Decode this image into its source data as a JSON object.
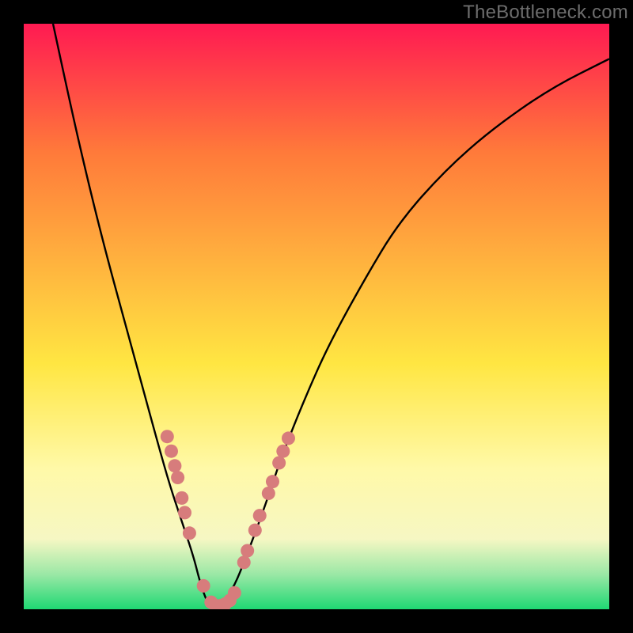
{
  "watermark": "TheBottleneck.com",
  "colors": {
    "black": "#000000",
    "curve": "#000000",
    "marker_fill": "#d77c7c",
    "marker_stroke": "#b85e5e",
    "gradient_top": "#ff1a52",
    "gradient_mid_orange": "#ff7a3a",
    "gradient_yellow": "#ffe642",
    "gradient_pale_yellow": "#fff9a8",
    "gradient_cream": "#f6f7c3",
    "gradient_mint": "#9be8a6",
    "gradient_green": "#1fd873"
  },
  "chart_data": {
    "type": "line",
    "title": "",
    "xlabel": "",
    "ylabel": "",
    "xlim": [
      0,
      100
    ],
    "ylim": [
      0,
      100
    ],
    "series": [
      {
        "name": "bottleneck-curve",
        "x": [
          5,
          8,
          11,
          14,
          17,
          20,
          23,
          25,
          27,
          29,
          30,
          31,
          32,
          33,
          34,
          36,
          38,
          41,
          44,
          48,
          52,
          58,
          64,
          72,
          80,
          90,
          100
        ],
        "y": [
          100,
          86,
          73,
          61,
          50,
          39,
          28,
          21,
          15,
          9,
          5,
          2,
          0,
          0,
          1,
          4,
          9,
          17,
          26,
          36,
          45,
          56,
          66,
          75,
          82,
          89,
          94
        ]
      }
    ],
    "markers": [
      {
        "x": 24.5,
        "y": 29.5
      },
      {
        "x": 25.2,
        "y": 27.0
      },
      {
        "x": 25.8,
        "y": 24.5
      },
      {
        "x": 26.3,
        "y": 22.5
      },
      {
        "x": 27.0,
        "y": 19.0
      },
      {
        "x": 27.5,
        "y": 16.5
      },
      {
        "x": 28.3,
        "y": 13.0
      },
      {
        "x": 30.7,
        "y": 4.0
      },
      {
        "x": 32.0,
        "y": 1.2
      },
      {
        "x": 32.8,
        "y": 0.6
      },
      {
        "x": 33.6,
        "y": 0.6
      },
      {
        "x": 34.4,
        "y": 0.9
      },
      {
        "x": 35.2,
        "y": 1.5
      },
      {
        "x": 36.0,
        "y": 2.8
      },
      {
        "x": 37.6,
        "y": 8.0
      },
      {
        "x": 38.2,
        "y": 10.0
      },
      {
        "x": 39.5,
        "y": 13.5
      },
      {
        "x": 40.3,
        "y": 16.0
      },
      {
        "x": 41.8,
        "y": 19.8
      },
      {
        "x": 42.5,
        "y": 21.8
      },
      {
        "x": 43.6,
        "y": 25.0
      },
      {
        "x": 44.3,
        "y": 27.0
      },
      {
        "x": 45.2,
        "y": 29.2
      }
    ],
    "gradient_stops": [
      {
        "offset": 0.0,
        "color_key": "gradient_top"
      },
      {
        "offset": 0.22,
        "color_key": "gradient_mid_orange"
      },
      {
        "offset": 0.58,
        "color_key": "gradient_yellow"
      },
      {
        "offset": 0.76,
        "color_key": "gradient_pale_yellow"
      },
      {
        "offset": 0.88,
        "color_key": "gradient_cream"
      },
      {
        "offset": 0.94,
        "color_key": "gradient_mint"
      },
      {
        "offset": 1.0,
        "color_key": "gradient_green"
      }
    ]
  }
}
